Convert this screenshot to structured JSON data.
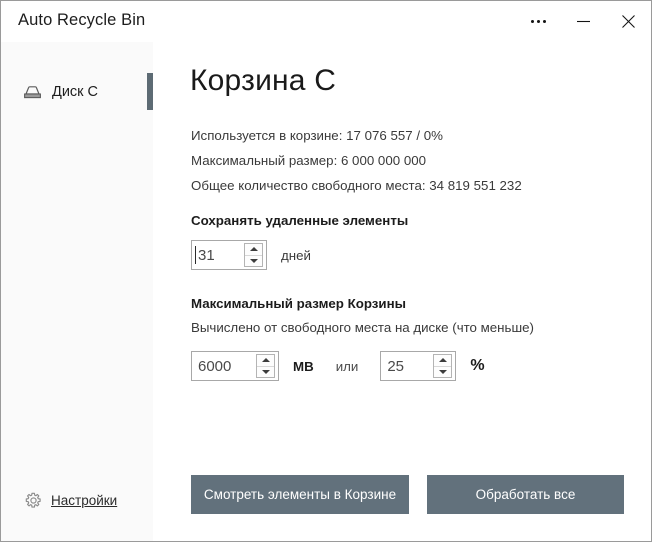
{
  "window": {
    "title": "Auto Recycle Bin",
    "controls": [
      {
        "name": "more-options",
        "glyph": "•••"
      },
      {
        "name": "minimize",
        "glyph": "—"
      },
      {
        "name": "close",
        "glyph": "✕"
      }
    ]
  },
  "sidebar": {
    "items": [
      {
        "label": "Диск С",
        "icon": "drive-icon",
        "selected": true
      }
    ],
    "settings": {
      "label": "Настройки",
      "icon": "gear-icon"
    }
  },
  "main": {
    "page_title": "Корзина С",
    "info_lines": [
      "Используется в корзине: 17 076 557 / 0%",
      "Максимальный размер: 6 000 000 000",
      "Общее количество свободного места: 34 819 551 232"
    ],
    "keep_section": {
      "heading": "Сохранять удаленные элементы",
      "value": "31",
      "unit": "дней"
    },
    "maxsize_section": {
      "heading": "Максимальный размер Корзины",
      "subtitle": "Вычислено от свободного места на диске (что меньше)",
      "mb_value": "6000",
      "mb_unit": "MB",
      "conjunction": "или",
      "pct_value": "25",
      "pct_unit": "%"
    },
    "buttons": {
      "view_items": "Смотреть элементы в Корзине",
      "process_all": "Обработать все"
    }
  },
  "colors": {
    "accent_bar": "#5d6b74",
    "button_bg": "#62717c",
    "sidebar_bg": "#fafafa",
    "window_border": "#9a9a9a"
  }
}
